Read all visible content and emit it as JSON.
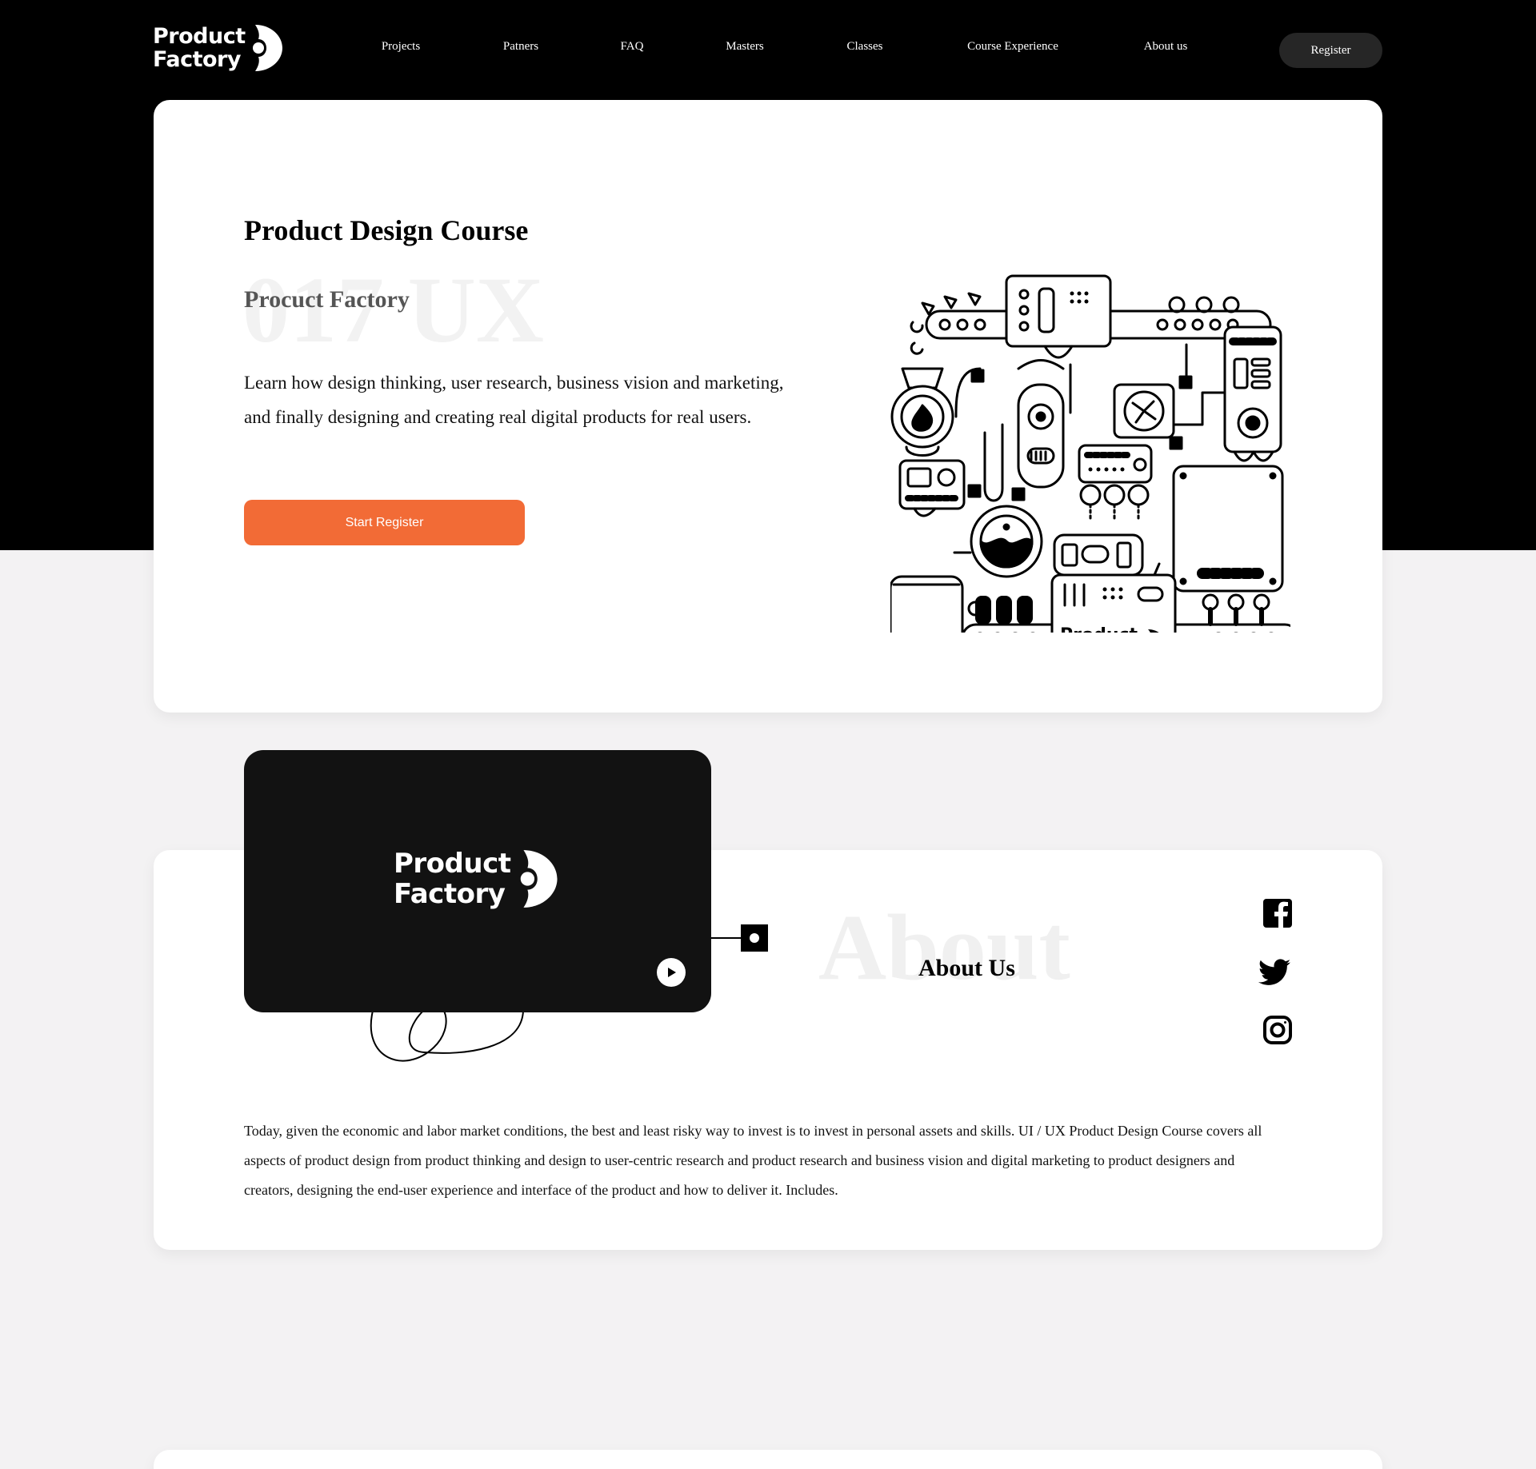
{
  "brand": {
    "line1": "Product",
    "line2": "Factory"
  },
  "nav": {
    "items": [
      "Projects",
      "Patners",
      "FAQ",
      "Masters",
      "Classes",
      "Course Experience",
      "About us"
    ],
    "register_label": "Register"
  },
  "hero": {
    "title": "Product Design Course",
    "ghost_text": "017 UX",
    "subtitle": "Procuct Factory",
    "description": "Learn how design thinking, user research, business vision and marketing, and finally designing and creating real digital products for real users.",
    "cta_label": "Start Register",
    "illustration_icon": "factory-machine-illustration"
  },
  "about": {
    "ghost_text": "About",
    "title": "About Us",
    "video_icon": "play-icon",
    "social_icons": [
      "facebook-icon",
      "twitter-icon",
      "instagram-icon"
    ],
    "text": "Today, given the economic and labor market conditions, the best and least risky way to invest is to invest in personal assets and skills. UI / UX Product Design Course covers all aspects of product design from product thinking and design to user-centric research and product research and business vision and digital marketing to product designers and creators, designing the end-user experience and interface of the product and how to deliver it. Includes."
  },
  "colors": {
    "accent": "#f26b36",
    "dark": "#000000",
    "page_bg": "#f3f2f3",
    "card_bg": "#ffffff"
  }
}
